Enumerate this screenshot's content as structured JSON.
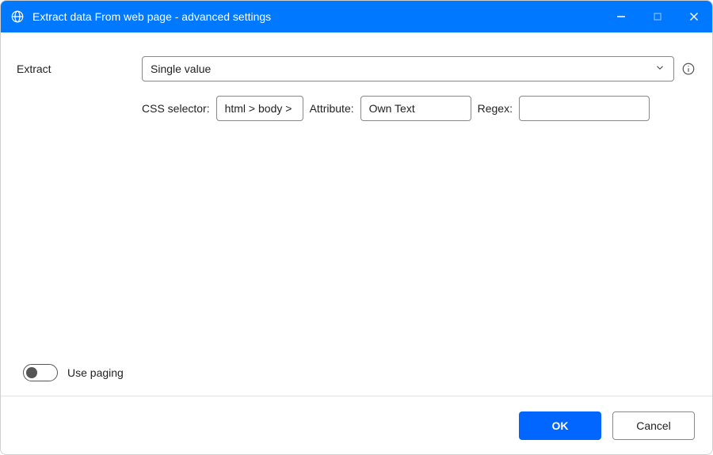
{
  "window": {
    "title": "Extract data From web page - advanced settings"
  },
  "form": {
    "extract_label": "Extract",
    "extract_value": "Single value",
    "css_selector_label": "CSS selector:",
    "css_selector_value": "html > body >",
    "attribute_label": "Attribute:",
    "attribute_value": "Own Text",
    "regex_label": "Regex:",
    "regex_value": ""
  },
  "paging": {
    "label": "Use paging",
    "enabled": false
  },
  "footer": {
    "ok": "OK",
    "cancel": "Cancel"
  }
}
